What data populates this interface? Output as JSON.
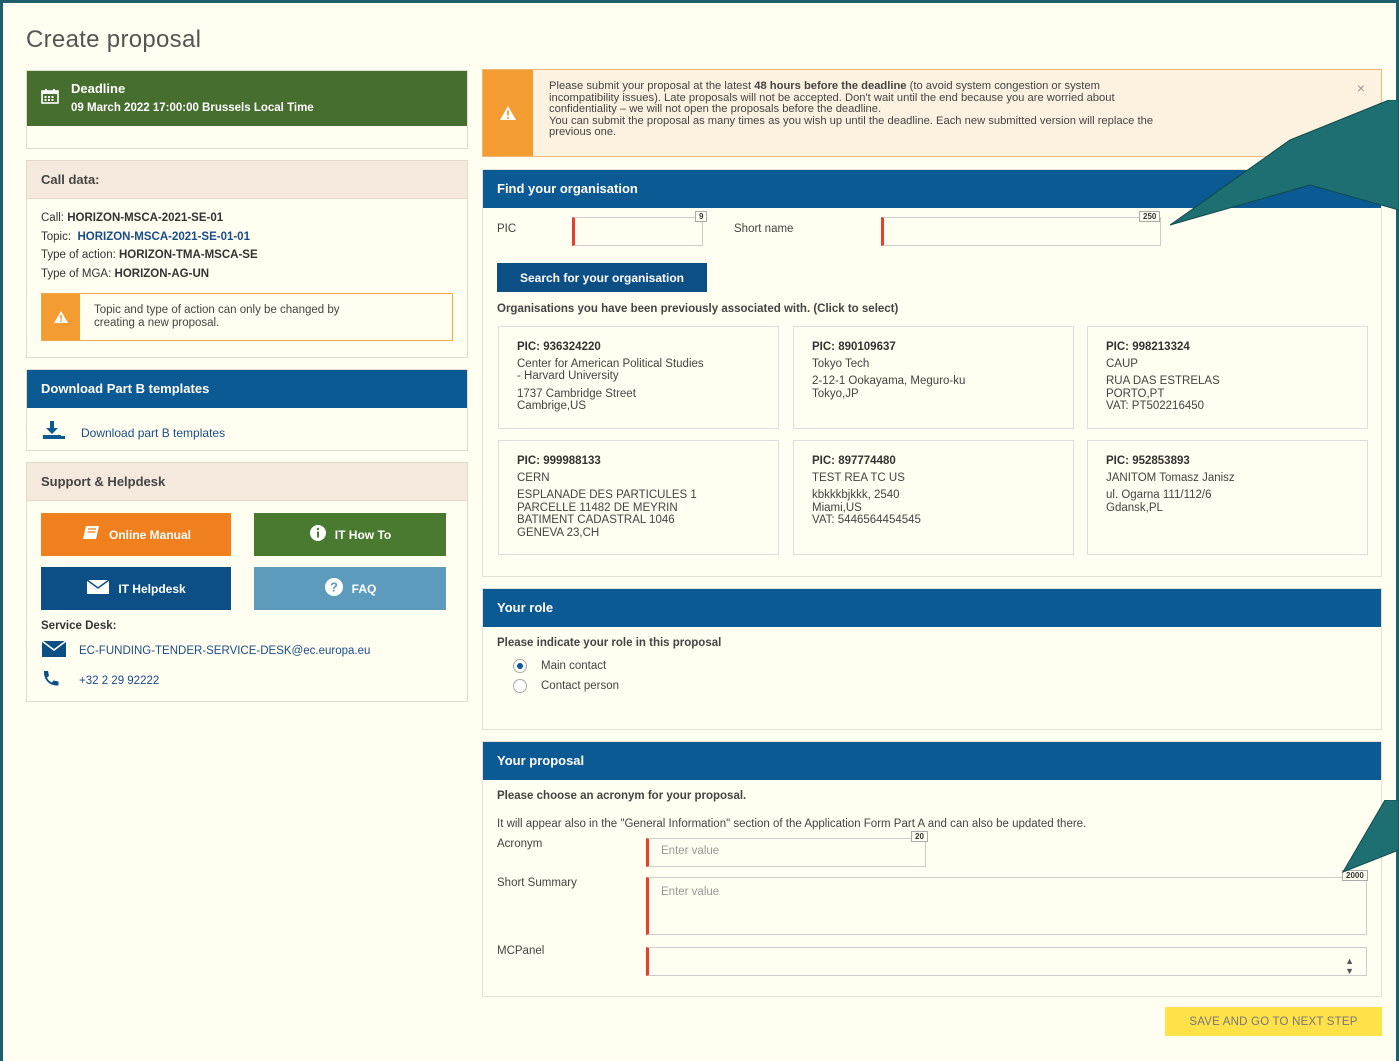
{
  "page": {
    "title": "Create proposal"
  },
  "deadline": {
    "label": "Deadline",
    "value": "09 March 2022 17:00:00 Brussels Local Time"
  },
  "call_data": {
    "header": "Call data:",
    "call_label": "Call:",
    "call_value": "HORIZON-MSCA-2021-SE-01",
    "topic_label": "Topic:",
    "topic_value": "HORIZON-MSCA-2021-SE-01-01",
    "action_label": "Type of action:",
    "action_value": "HORIZON-TMA-MSCA-SE",
    "mga_label": "Type of MGA:",
    "mga_value": "HORIZON-AG-UN",
    "warning_line1": "Topic and type of action can only be changed by",
    "warning_line2": "creating a new proposal."
  },
  "download": {
    "header": "Download Part B templates",
    "link": "Download part B templates"
  },
  "support": {
    "header": "Support & Helpdesk",
    "online_manual": "Online Manual",
    "it_how_to": "IT How To",
    "it_helpdesk": "IT Helpdesk",
    "faq": "FAQ",
    "service_desk_label": "Service Desk:",
    "email": "EC-FUNDING-TENDER-SERVICE-DESK@ec.europa.eu",
    "phone": "+32 2 29 92222"
  },
  "banner": {
    "line1_pre": "Please submit your proposal at the latest ",
    "line1_bold": "48 hours before the deadline",
    "line1_post": " (to avoid system congestion or system",
    "line2": "incompatibility issues). Late proposals will not be accepted. Don't wait until the end because you are worried about",
    "line3": "confidentiality – we will not open the proposals before the deadline.",
    "line4": "You can submit the proposal as many times as you wish up until the deadline. Each new submitted version will replace the",
    "line5": "previous one.",
    "close": "×"
  },
  "find_org": {
    "header": "Find your organisation",
    "pic_label": "PIC",
    "pic_counter": "9",
    "short_name_label": "Short name",
    "short_name_counter": "250",
    "search_button": "Search for your organisation",
    "associated_label": "Organisations you have been previously associated with. (Click to select)",
    "orgs": [
      {
        "pic": "PIC: 936324220",
        "name1": "Center for American Political Studies",
        "name2": "- Harvard University",
        "addr1": "1737 Cambridge Street",
        "addr2": "Cambrige,US",
        "addr3": "",
        "addr4": ""
      },
      {
        "pic": "PIC: 890109637",
        "name1": "Tokyo Tech",
        "name2": "",
        "addr1": "2-12-1 Ookayama, Meguro-ku",
        "addr2": "Tokyo,JP",
        "addr3": "",
        "addr4": ""
      },
      {
        "pic": "PIC: 998213324",
        "name1": "CAUP",
        "name2": "",
        "addr1": "RUA DAS ESTRELAS",
        "addr2": "PORTO,PT",
        "addr3": "VAT: PT502216450",
        "addr4": ""
      },
      {
        "pic": "PIC: 999988133",
        "name1": "CERN",
        "name2": "",
        "addr1": "ESPLANADE DES PARTICULES 1",
        "addr2": "PARCELLE 11482 DE MEYRIN",
        "addr3": "BATIMENT CADASTRAL 1046",
        "addr4": "GENEVA 23,CH"
      },
      {
        "pic": "PIC: 897774480",
        "name1": "TEST REA TC US",
        "name2": "",
        "addr1": "kbkkkbjkkk, 2540",
        "addr2": "Miami,US",
        "addr3": "VAT: 5446564454545",
        "addr4": ""
      },
      {
        "pic": "PIC: 952853893",
        "name1": "JANITOM Tomasz Janisz",
        "name2": "",
        "addr1": "ul. Ogarna 111/112/6",
        "addr2": "Gdansk,PL",
        "addr3": "",
        "addr4": ""
      }
    ]
  },
  "role": {
    "header": "Your role",
    "question": "Please indicate your role in this proposal",
    "option_main": "Main contact",
    "option_contact": "Contact person",
    "selected": "Main contact"
  },
  "proposal": {
    "header": "Your proposal",
    "question": "Please choose an acronym for your proposal.",
    "note": "It will appear also in the \"General Information\" section of the Application Form Part A and can also be updated there.",
    "acronym_label": "Acronym",
    "acronym_counter": "20",
    "acronym_placeholder": "Enter value",
    "summary_label": "Short Summary",
    "summary_counter": "2000",
    "summary_placeholder": "Enter value",
    "mcpanel_label": "MCPanel",
    "mcpanel_value": ""
  },
  "save_button": "SAVE AND GO TO NEXT STEP",
  "colors": {
    "primary_blue": "#0c5a94",
    "green": "#466f2f",
    "orange": "#f07f1e",
    "warning": "#f39c31",
    "required_red": "#e6402d",
    "save_yellow": "#ffe14a",
    "callout_teal": "#1d5f6a"
  }
}
